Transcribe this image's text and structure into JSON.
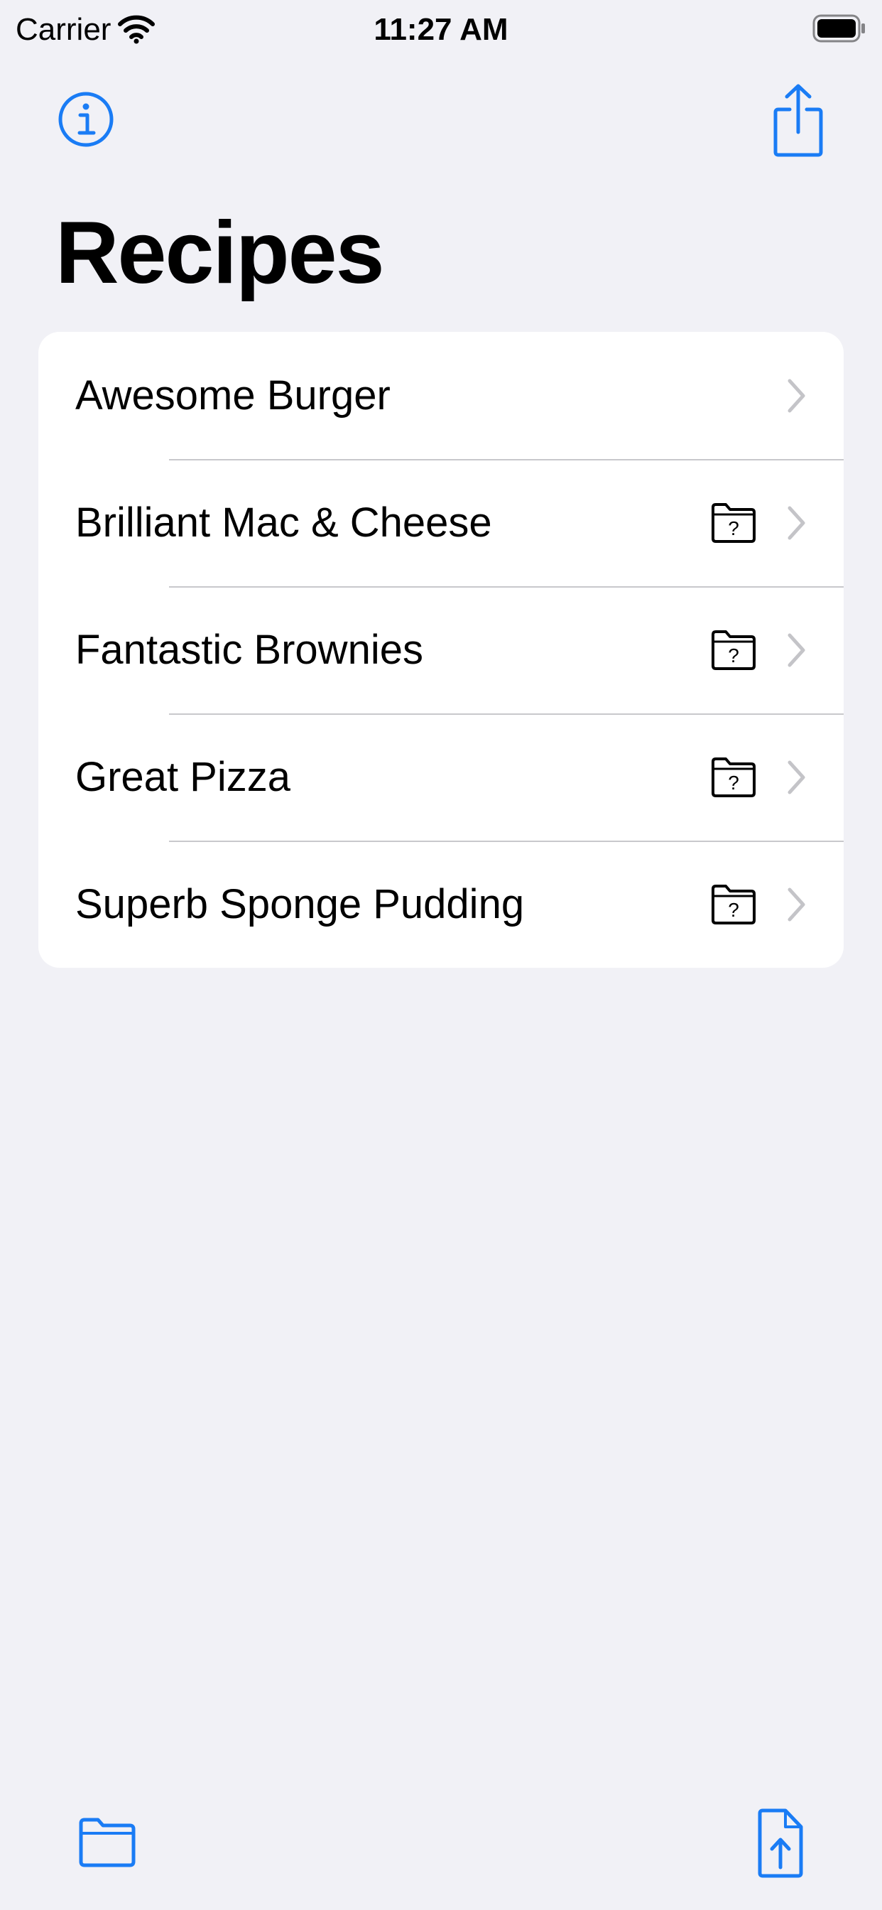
{
  "status_bar": {
    "carrier": "Carrier",
    "time": "11:27 AM"
  },
  "nav": {
    "left_icon": "info-circle-icon",
    "right_icon": "share-icon"
  },
  "title": "Recipes",
  "recipes": [
    {
      "label": "Awesome Burger",
      "has_folder_badge": false
    },
    {
      "label": "Brilliant Mac & Cheese",
      "has_folder_badge": true
    },
    {
      "label": "Fantastic Brownies",
      "has_folder_badge": true
    },
    {
      "label": "Great Pizza",
      "has_folder_badge": true
    },
    {
      "label": "Superb Sponge Pudding",
      "has_folder_badge": true
    }
  ],
  "toolbar": {
    "left_icon": "folder-icon",
    "right_icon": "document-upload-icon"
  },
  "colors": {
    "accent": "#1a7cf5",
    "background": "#f1f1f6",
    "card": "#ffffff",
    "separator": "#c8c8cc",
    "chevron": "#c4c4c8"
  }
}
